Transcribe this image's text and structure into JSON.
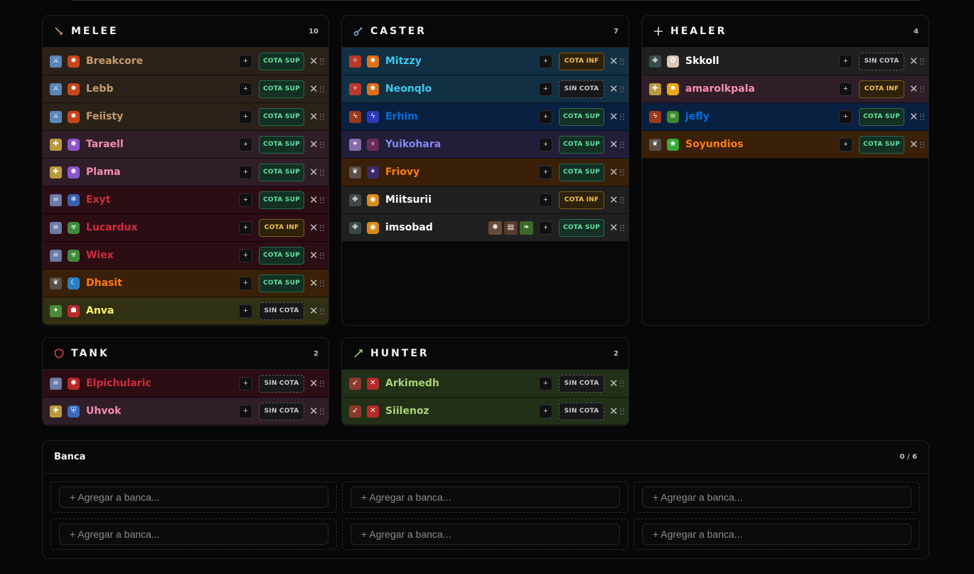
{
  "colors": {
    "death_knight": "#3a0f14",
    "paladin": "#2f1d28",
    "warrior": "#2a2218",
    "monk": "#172a26",
    "priest": "#202020",
    "demon_hunter": "#2a1830",
    "mage": "#123044",
    "druid": "#3a2008",
    "evoker": "#18302a",
    "rogue": "#323012",
    "shaman": "#0a2040",
    "warlock": "#221e3a",
    "hunter": "#223018",
    "sup": "#5fe3a1",
    "inf": "#f4c34e",
    "sin": "#c9c9cf"
  },
  "panels": [
    {
      "key": "melee",
      "title": "MELEE",
      "count": "10",
      "icon": "sword-icon",
      "players": [
        {
          "name": "Breakcore",
          "name_color": "#c69b6d",
          "bg": "#2a2218",
          "class_icon": "warrior-class-icon",
          "class_glyph": "⚔",
          "class_color": "#5a86b8",
          "spec_icon": "fury-spec-icon",
          "spec_glyph": "✹",
          "spec_color": "#c4461a",
          "cota": "COTA SUP",
          "cota_type": "sup"
        },
        {
          "name": "Lebb",
          "name_color": "#c69b6d",
          "bg": "#2a2218",
          "class_icon": "warrior-class-icon",
          "class_glyph": "⚔",
          "class_color": "#5a86b8",
          "spec_icon": "fury-spec-icon",
          "spec_glyph": "✹",
          "spec_color": "#c4461a",
          "cota": "COTA SUP",
          "cota_type": "sup"
        },
        {
          "name": "Feiisty",
          "name_color": "#c69b6d",
          "bg": "#2a2218",
          "class_icon": "warrior-class-icon",
          "class_glyph": "⚔",
          "class_color": "#5a86b8",
          "spec_icon": "fury-spec-icon",
          "spec_glyph": "✹",
          "spec_color": "#c4461a",
          "cota": "COTA SUP",
          "cota_type": "sup"
        },
        {
          "name": "Taraell",
          "name_color": "#f48cba",
          "bg": "#2f1d28",
          "class_icon": "paladin-class-icon",
          "class_glyph": "✚",
          "class_color": "#b89a3e",
          "spec_icon": "retribution-spec-icon",
          "spec_glyph": "✺",
          "spec_color": "#8a54c8",
          "cota": "COTA SUP",
          "cota_type": "sup"
        },
        {
          "name": "Plama",
          "name_color": "#f48cba",
          "bg": "#2f1d28",
          "class_icon": "paladin-class-icon",
          "class_glyph": "✚",
          "class_color": "#b89a3e",
          "spec_icon": "retribution-spec-icon",
          "spec_glyph": "✺",
          "spec_color": "#8a54c8",
          "cota": "COTA SUP",
          "cota_type": "sup"
        },
        {
          "name": "Exyt",
          "name_color": "#d12b3f",
          "bg": "#2c0d13",
          "class_icon": "death-knight-class-icon",
          "class_glyph": "☠",
          "class_color": "#6a7aa8",
          "spec_icon": "frost-spec-icon",
          "spec_glyph": "❄",
          "spec_color": "#3a5fae",
          "cota": "COTA SUP",
          "cota_type": "sup"
        },
        {
          "name": "Lucardux",
          "name_color": "#d12b3f",
          "bg": "#2c0d13",
          "class_icon": "death-knight-class-icon",
          "class_glyph": "☠",
          "class_color": "#6a7aa8",
          "spec_icon": "unholy-spec-icon",
          "spec_glyph": "☣",
          "spec_color": "#3e8a3a",
          "cota": "COTA INF",
          "cota_type": "inf"
        },
        {
          "name": "Wiex",
          "name_color": "#d12b3f",
          "bg": "#2c0d13",
          "class_icon": "death-knight-class-icon",
          "class_glyph": "☠",
          "class_color": "#6a7aa8",
          "spec_icon": "unholy-spec-icon",
          "spec_glyph": "☣",
          "spec_color": "#3e8a3a",
          "cota": "COTA SUP",
          "cota_type": "sup"
        },
        {
          "name": "Dhasit",
          "name_color": "#ff7c0a",
          "bg": "#3a2008",
          "class_icon": "druid-class-icon",
          "class_glyph": "❦",
          "class_color": "#5a5048",
          "spec_icon": "feral-spec-icon",
          "spec_glyph": "☾",
          "spec_color": "#2a7fc4",
          "cota": "COTA SUP",
          "cota_type": "sup"
        },
        {
          "name": "Anva",
          "name_color": "#fff468",
          "bg": "#323012",
          "class_icon": "rogue-class-icon",
          "class_glyph": "✦",
          "class_color": "#4a8a3a",
          "spec_icon": "outlaw-spec-icon",
          "spec_glyph": "☗",
          "spec_color": "#b82a2a",
          "cota": "SIN COTA",
          "cota_type": "sin"
        }
      ]
    },
    {
      "key": "caster",
      "title": "CASTER",
      "count": "7",
      "icon": "wand-icon",
      "players": [
        {
          "name": "Mitzzy",
          "name_color": "#3fc7eb",
          "bg": "#123044",
          "class_icon": "mage-class-icon",
          "class_glyph": "✧",
          "class_color": "#b8382a",
          "spec_icon": "fire-spec-icon",
          "spec_glyph": "✸",
          "spec_color": "#e0701a",
          "cota": "COTA INF",
          "cota_type": "inf"
        },
        {
          "name": "Neonqlo",
          "name_color": "#3fc7eb",
          "bg": "#123044",
          "class_icon": "mage-class-icon",
          "class_glyph": "✧",
          "class_color": "#b8382a",
          "spec_icon": "fire-spec-icon",
          "spec_glyph": "✸",
          "spec_color": "#e0701a",
          "cota": "SIN COTA",
          "cota_type": "sin"
        },
        {
          "name": "Erhim",
          "name_color": "#0070dd",
          "bg": "#0a2040",
          "class_icon": "shaman-class-icon",
          "class_glyph": "ϟ",
          "class_color": "#9a3a1a",
          "spec_icon": "elemental-spec-icon",
          "spec_glyph": "ϟ",
          "spec_color": "#2a3ab8",
          "cota": "COTA SUP",
          "cota_type": "sup"
        },
        {
          "name": "Yuikohara",
          "name_color": "#8788ee",
          "bg": "#221e3a",
          "class_icon": "warlock-class-icon",
          "class_glyph": "✴",
          "class_color": "#8a6aa8",
          "spec_icon": "destruction-spec-icon",
          "spec_glyph": "♆",
          "spec_color": "#6a2a5a",
          "cota": "COTA SUP",
          "cota_type": "sup"
        },
        {
          "name": "Friovy",
          "name_color": "#ff7c0a",
          "bg": "#3a2008",
          "class_icon": "druid-class-icon",
          "class_glyph": "❦",
          "class_color": "#5a5048",
          "spec_icon": "balance-spec-icon",
          "spec_glyph": "✶",
          "spec_color": "#3a2a6a",
          "cota": "COTA SUP",
          "cota_type": "sup"
        },
        {
          "name": "Miitsurii",
          "name_color": "#ffffff",
          "bg": "#202020",
          "class_icon": "priest-class-icon",
          "class_glyph": "✙",
          "class_color": "#3a4a4a",
          "spec_icon": "shadow-spec-icon",
          "spec_glyph": "◉",
          "spec_color": "#d88a1a",
          "cota": "COTA INF",
          "cota_type": "inf"
        },
        {
          "name": "imsobad",
          "name_color": "#ffffff",
          "bg": "#202020",
          "class_icon": "priest-class-icon",
          "class_glyph": "✙",
          "class_color": "#3a4a4a",
          "spec_icon": "shadow-spec-icon",
          "spec_glyph": "◉",
          "spec_color": "#d88a1a",
          "cota": "COTA SUP",
          "cota_type": "sup",
          "extras": [
            {
              "icon": "trinket-icon",
              "glyph": "✺",
              "color": "#6a4a3a"
            },
            {
              "icon": "scroll-icon",
              "glyph": "▤",
              "color": "#5a3a2a"
            },
            {
              "icon": "vines-icon",
              "glyph": "❧",
              "color": "#3a6a2a"
            }
          ]
        }
      ]
    },
    {
      "key": "healer",
      "title": "HEALER",
      "count": "4",
      "icon": "plus-icon",
      "players": [
        {
          "name": "Skkoll",
          "name_color": "#ffffff",
          "bg": "#202020",
          "class_icon": "priest-class-icon",
          "class_glyph": "✙",
          "class_color": "#3a4a4a",
          "spec_icon": "holy-spec-icon",
          "spec_glyph": "❂",
          "spec_color": "#d8c8b8",
          "cota": "SIN COTA",
          "cota_type": "sin"
        },
        {
          "name": "amarolkpala",
          "name_color": "#f48cba",
          "bg": "#2f1d28",
          "class_icon": "paladin-class-icon",
          "class_glyph": "✚",
          "class_color": "#b89a3e",
          "spec_icon": "holy-paladin-spec-icon",
          "spec_glyph": "✹",
          "spec_color": "#e8a81a",
          "cota": "COTA INF",
          "cota_type": "inf"
        },
        {
          "name": "jefly",
          "name_color": "#0070dd",
          "bg": "#0a2040",
          "class_icon": "shaman-class-icon",
          "class_glyph": "ϟ",
          "class_color": "#9a3a1a",
          "spec_icon": "restoration-spec-icon",
          "spec_glyph": "≋",
          "spec_color": "#3a8a2a",
          "cota": "COTA SUP",
          "cota_type": "sup"
        },
        {
          "name": "Soyundios",
          "name_color": "#ff7c0a",
          "bg": "#3a2008",
          "class_icon": "druid-class-icon",
          "class_glyph": "❦",
          "class_color": "#5a5048",
          "spec_icon": "restoration-druid-spec-icon",
          "spec_glyph": "❀",
          "spec_color": "#3aa83a",
          "cota": "COTA SUP",
          "cota_type": "sup"
        }
      ]
    },
    {
      "key": "tank",
      "title": "TANK",
      "count": "2",
      "icon": "shield-icon",
      "players": [
        {
          "name": "Elpichularic",
          "name_color": "#d12b3f",
          "bg": "#2c0d13",
          "class_icon": "death-knight-class-icon",
          "class_glyph": "☠",
          "class_color": "#6a7aa8",
          "spec_icon": "blood-spec-icon",
          "spec_glyph": "✺",
          "spec_color": "#b82a2a",
          "cota": "SIN COTA",
          "cota_type": "sin"
        },
        {
          "name": "Uhvok",
          "name_color": "#f48cba",
          "bg": "#2f1d28",
          "class_icon": "paladin-class-icon",
          "class_glyph": "✚",
          "class_color": "#b89a3e",
          "spec_icon": "protection-spec-icon",
          "spec_glyph": "⛨",
          "spec_color": "#3a6ab8",
          "cota": "SIN COTA",
          "cota_type": "sin"
        }
      ]
    },
    {
      "key": "hunter",
      "title": "HUNTER",
      "count": "2",
      "icon": "arrow-icon",
      "players": [
        {
          "name": "Arkimedh",
          "name_color": "#aad372",
          "bg": "#223018",
          "class_icon": "hunter-class-icon",
          "class_glyph": "➶",
          "class_color": "#8a3a2a",
          "spec_icon": "marksmanship-spec-icon",
          "spec_glyph": "✕",
          "spec_color": "#b82a2a",
          "cota": "SIN COTA",
          "cota_type": "sin"
        },
        {
          "name": "Siilenoz",
          "name_color": "#aad372",
          "bg": "#223018",
          "class_icon": "hunter-class-icon",
          "class_glyph": "➶",
          "class_color": "#8a3a2a",
          "spec_icon": "marksmanship-spec-icon",
          "spec_glyph": "✕",
          "spec_color": "#b82a2a",
          "cota": "SIN COTA",
          "cota_type": "sin"
        }
      ]
    }
  ],
  "bank": {
    "title": "Banca",
    "count": "0 / 6",
    "placeholder": "+ Agregar a banca...",
    "slots": [
      "+ Agregar a banca...",
      "+ Agregar a banca...",
      "+ Agregar a banca...",
      "+ Agregar a banca...",
      "+ Agregar a banca...",
      "+ Agregar a banca..."
    ]
  },
  "labels": {
    "add": "+",
    "remove": "✕"
  }
}
